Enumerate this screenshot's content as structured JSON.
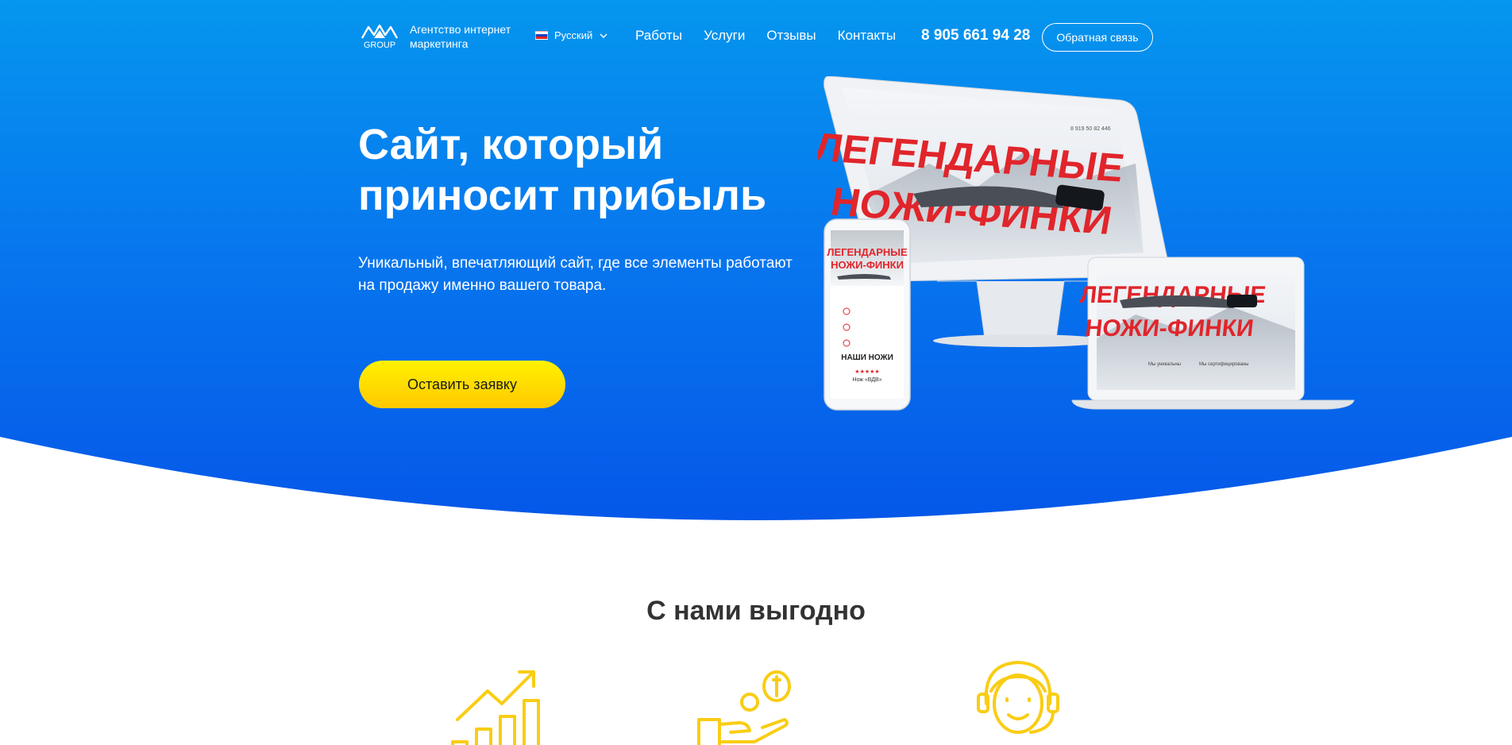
{
  "header": {
    "logo_text": "GROUP",
    "tagline": "Агентство интернет маркетинга",
    "language": "Русский",
    "nav": [
      "Работы",
      "Услуги",
      "Отзывы",
      "Контакты"
    ],
    "phone": "8 905 661 94 28",
    "callback_label": "Обратная связь"
  },
  "hero": {
    "title": "Сайт, который приносит прибыль",
    "subtitle": "Уникальный, впечатляющий сайт, где все элементы работают на продажу именно вашего товара.",
    "cta_label": "Оставить заявку"
  },
  "mockup": {
    "headline_line1": "ЛЕГЕНДАРНЫЕ",
    "headline_line2": "НОЖИ-ФИНКИ",
    "phone_section": "НАШИ НОЖИ",
    "phone_product": "Нож «ВДВ»",
    "phone_stars": "★★★★★",
    "site_phone": "8 919 50 82 446",
    "feature1": "Мы уникальны",
    "feature2": "Мы сертифицированы"
  },
  "benefits": {
    "title": "С нами выгодно",
    "icons": [
      "growth-chart-icon",
      "coins-hand-icon",
      "support-operator-icon"
    ]
  },
  "colors": {
    "hero_top": "#0596ee",
    "hero_bottom": "#0556e8",
    "cta_yellow": "#ffd400",
    "icon_yellow": "#f9cd14",
    "mockup_red": "#e0252b"
  }
}
